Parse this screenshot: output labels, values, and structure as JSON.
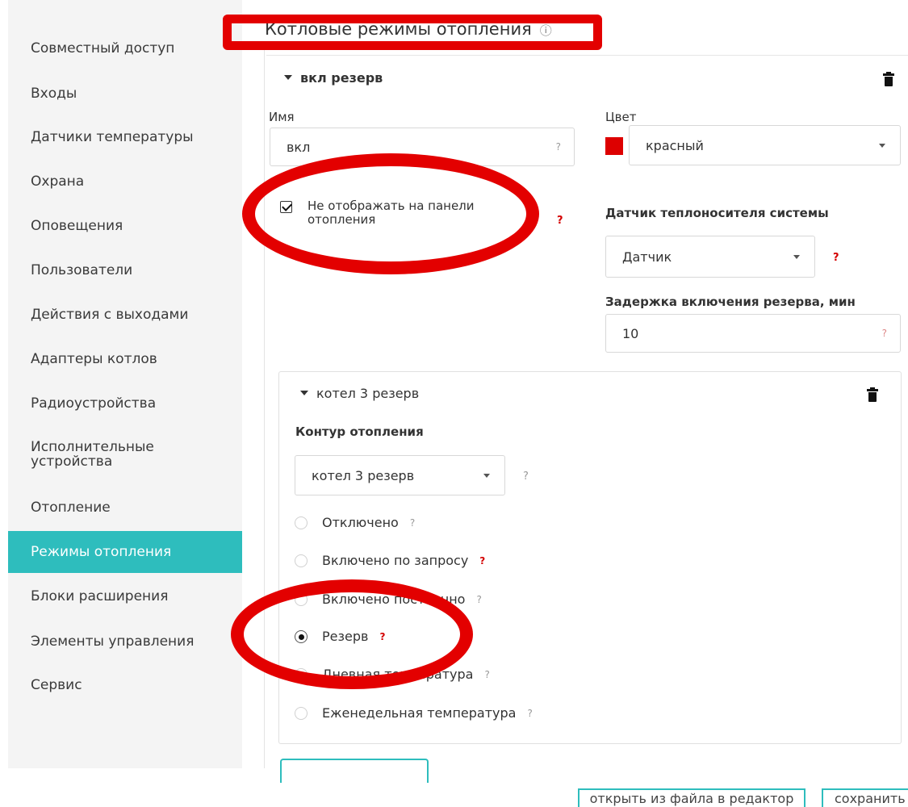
{
  "sidebar": {
    "items": [
      {
        "label": "Совместный доступ"
      },
      {
        "label": "Входы"
      },
      {
        "label": "Датчики температуры"
      },
      {
        "label": "Охрана"
      },
      {
        "label": "Оповещения"
      },
      {
        "label": "Пользователи"
      },
      {
        "label": "Действия с выходами"
      },
      {
        "label": "Адаптеры котлов"
      },
      {
        "label": "Радиоустройства"
      },
      {
        "label": "Исполнительные",
        "label2": "устройства"
      },
      {
        "label": "Отопление"
      },
      {
        "label": "Режимы отопления",
        "active": true
      },
      {
        "label": "Блоки расширения"
      },
      {
        "label": "Элементы управления"
      },
      {
        "label": "Сервис"
      }
    ]
  },
  "header": {
    "title": "Котловые режимы отопления",
    "help_icon": "help-circle-icon"
  },
  "mode": {
    "name_heading": "вкл резерв",
    "name_label": "Имя",
    "name_value": "вкл",
    "color_label": "Цвет",
    "color_value": "красный",
    "color_hex": "#dd0000",
    "hide_checkbox_label": "Не отображать на панели отопления",
    "hide_checked": true,
    "sensor_label": "Датчик теплоносителя системы",
    "sensor_value": "Датчик",
    "delay_label": "Задержка включения резерва, мин",
    "delay_value": "10"
  },
  "circuit": {
    "heading": "котел 3 резерв",
    "contour_label": "Контур отопления",
    "contour_value": "котел 3 резерв",
    "options": [
      {
        "label": "Отключено",
        "selected": false,
        "help_red": false
      },
      {
        "label": "Включено по запросу",
        "selected": false,
        "help_red": true
      },
      {
        "label": "Включено постоянно",
        "selected": false,
        "help_red": false
      },
      {
        "label": "Резерв",
        "selected": true,
        "help_red": true
      },
      {
        "label": "Дневная температура",
        "selected": false,
        "help_red": false
      },
      {
        "label": "Еженедельная температура",
        "selected": false,
        "help_red": false
      }
    ]
  },
  "footer": {
    "open_button": "открыть из файла в редактор",
    "save_button": "сохранить"
  },
  "help_glyph": "?",
  "accent_color": "#2ebdbd",
  "annotation_color": "#e30000"
}
